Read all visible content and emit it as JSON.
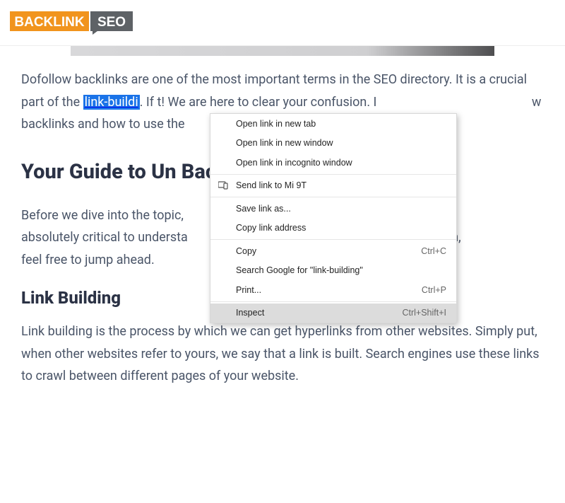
{
  "logo": {
    "text_left": "BACKLINK",
    "text_right": "SEO"
  },
  "article": {
    "p1_before": "Dofollow backlinks are one of the most important terms in the SEO directory. It is a crucial part of the ",
    "p1_link": "link-buildi",
    "p1_after_1": ". If t! We are here to clear your confusion. I ",
    "p1_after_2": "w backlinks and how to use the",
    "h2": "Your Guide to Un Backlink",
    "p2": "Before we dive into the topic, hat are absolutely critical to understa ow them, feel free to jump ahead.",
    "h3": "Link Building",
    "p3": "Link building is the process by which we can get hyperlinks from other websites. Simply put, when other websites refer to yours, we say that a link is built. Search engines use these links to crawl between different pages of your website."
  },
  "context_menu": {
    "open_tab": "Open link in new tab",
    "open_window": "Open link in new window",
    "open_incognito": "Open link in incognito window",
    "send_to_device": "Send link to Mi 9T",
    "save_as": "Save link as...",
    "copy_link": "Copy link address",
    "copy": "Copy",
    "copy_sc": "Ctrl+C",
    "search": "Search Google for \"link-building\"",
    "print": "Print...",
    "print_sc": "Ctrl+P",
    "inspect": "Inspect",
    "inspect_sc": "Ctrl+Shift+I"
  }
}
